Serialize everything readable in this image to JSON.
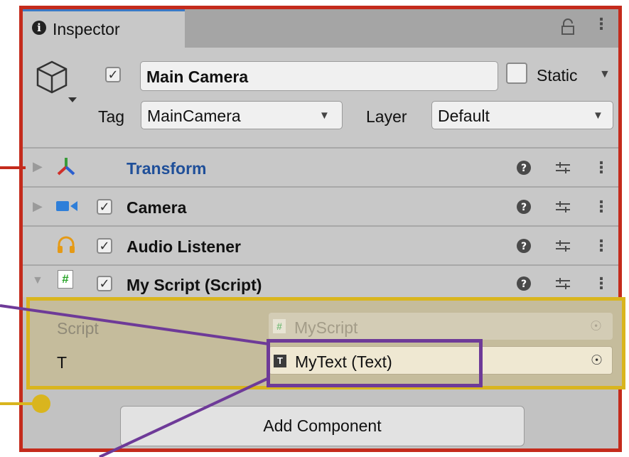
{
  "tab": {
    "title": "Inspector",
    "info_icon": "info-icon",
    "lock_icon": "lock-icon",
    "menu_icon": "kebab-menu-icon"
  },
  "object": {
    "name": "Main Camera",
    "active": true,
    "static_label": "Static",
    "static_checked": false,
    "tag_label": "Tag",
    "tag_value": "MainCamera",
    "layer_label": "Layer",
    "layer_value": "Default"
  },
  "components": [
    {
      "name": "Transform",
      "icon": "transform-axes-icon",
      "expanded": false,
      "has_checkbox": false
    },
    {
      "name": "Camera",
      "icon": "camera-icon",
      "expanded": false,
      "has_checkbox": true
    },
    {
      "name": "Audio Listener",
      "icon": "headphones-icon",
      "expanded": false,
      "has_checkbox": true
    },
    {
      "name": "My Script (Script)",
      "icon": "csharp-script-icon",
      "expanded": true,
      "has_checkbox": true
    }
  ],
  "script_fields": {
    "script_label": "Script",
    "script_value": "MyScript",
    "t_label": "T",
    "t_value": "MyText (Text)"
  },
  "add_component_label": "Add Component",
  "colors": {
    "frame": "#c42b1c",
    "highlight": "#d9b51e",
    "selection": "#6e3a98",
    "transform_title": "#1f4f99"
  }
}
